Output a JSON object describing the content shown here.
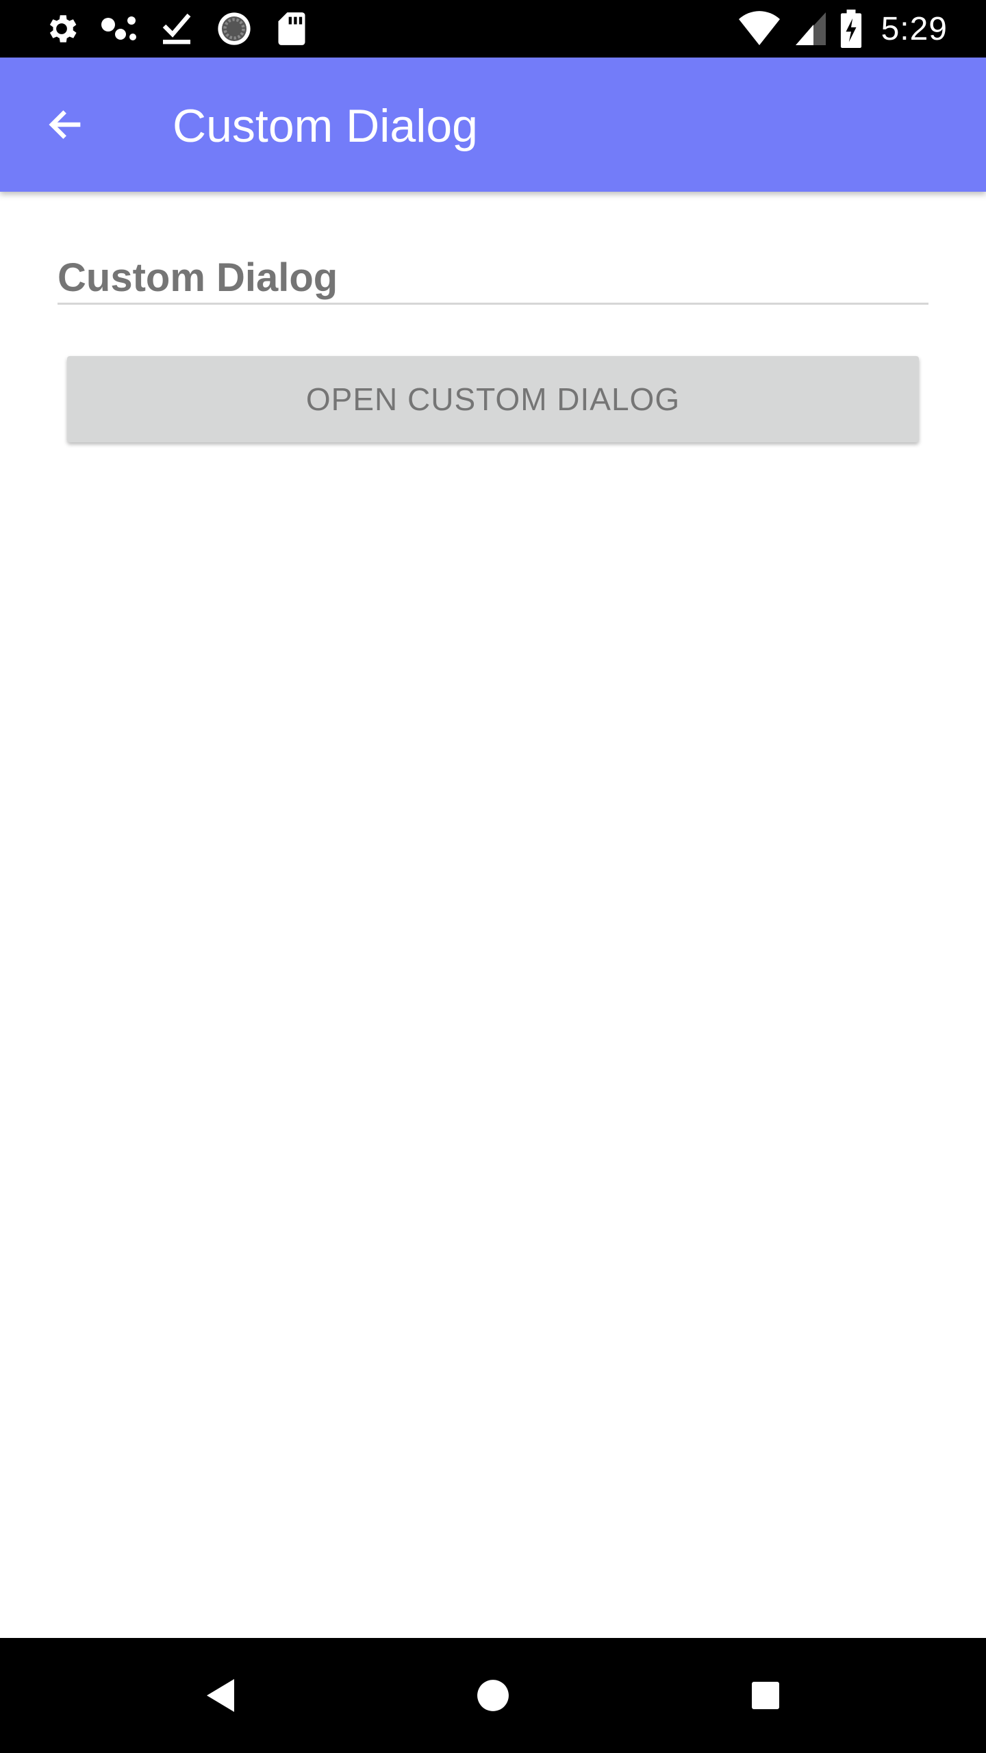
{
  "status_bar": {
    "time": "5:29",
    "left_icons": [
      "settings-icon",
      "assistant-dots-icon",
      "download-done-icon",
      "sync-progress-icon",
      "sd-card-icon"
    ],
    "right_icons": [
      "wifi-icon",
      "cell-signal-icon",
      "battery-charging-icon"
    ]
  },
  "app_bar": {
    "title": "Custom Dialog",
    "back_icon": "arrow-back-icon",
    "background_color": "#737cf9"
  },
  "main": {
    "text_field_value": "Custom Dialog",
    "open_button_label": "OPEN CUSTOM DIALOG"
  },
  "nav_bar": {
    "buttons": [
      "back-triangle-icon",
      "home-circle-icon",
      "recents-square-icon"
    ]
  }
}
